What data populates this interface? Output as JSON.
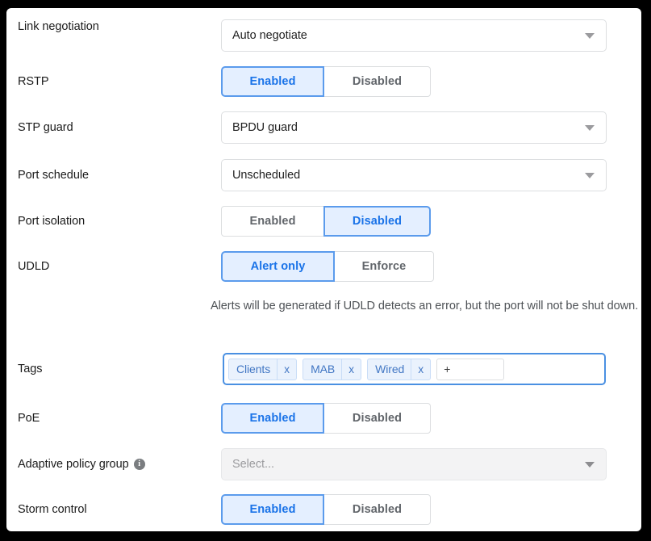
{
  "rows": [
    {
      "label": "Link negotiation",
      "type": "select",
      "value": "Auto negotiate",
      "disabled": false
    },
    {
      "label": "RSTP",
      "type": "toggle",
      "options": [
        "Enabled",
        "Disabled"
      ],
      "selected": "Enabled"
    },
    {
      "label": "STP guard",
      "type": "select",
      "value": "BPDU guard",
      "disabled": false
    },
    {
      "label": "Port schedule",
      "type": "select",
      "value": "Unscheduled",
      "disabled": false
    },
    {
      "label": "Port isolation",
      "type": "toggle",
      "options": [
        "Enabled",
        "Disabled"
      ],
      "selected": "Disabled"
    },
    {
      "label": "UDLD",
      "type": "toggle",
      "options": [
        "Alert only",
        "Enforce"
      ],
      "selected": "Alert only",
      "helper": "Alerts will be generated if UDLD detects an error, but the port will not be shut down."
    },
    {
      "label": "Tags",
      "type": "tags",
      "chips": [
        "Clients",
        "MAB",
        "Wired"
      ],
      "remove_glyph": "x",
      "add_glyph": "+"
    },
    {
      "label": "PoE",
      "type": "toggle",
      "options": [
        "Enabled",
        "Disabled"
      ],
      "selected": "Enabled"
    },
    {
      "label": "Adaptive policy group",
      "type": "select",
      "value": "Select...",
      "disabled": true,
      "info": true,
      "info_glyph": "i"
    },
    {
      "label": "Storm control",
      "type": "toggle",
      "options": [
        "Enabled",
        "Disabled"
      ],
      "selected": "Enabled"
    }
  ],
  "labels": {
    "link_negotiation": "Link negotiation",
    "rstp": "RSTP",
    "stp_guard": "STP guard",
    "port_schedule": "Port schedule",
    "port_isolation": "Port isolation",
    "udld": "UDLD",
    "tags": "Tags",
    "poe": "PoE",
    "adaptive_policy_group": "Adaptive policy group",
    "storm_control": "Storm control"
  },
  "values": {
    "link_negotiation": "Auto negotiate",
    "stp_guard": "BPDU guard",
    "port_schedule": "Unscheduled",
    "adaptive_policy_group_placeholder": "Select..."
  },
  "toggles": {
    "enabled": "Enabled",
    "disabled": "Disabled",
    "alert_only": "Alert only",
    "enforce": "Enforce"
  },
  "helper": {
    "udld": "Alerts will be generated if UDLD detects an error, but the port will not be shut down."
  },
  "tags": {
    "chip1": "Clients",
    "chip2": "MAB",
    "chip3": "Wired",
    "remove": "x",
    "add": "+"
  },
  "icons": {
    "info": "i"
  },
  "colors": {
    "accent_blue": "#1a73e8",
    "active_fill": "#e4efff",
    "active_border": "#5b9bec",
    "border_gray": "#dcdee0",
    "text": "#1b1b1b",
    "muted_text": "#62666b",
    "chip_fill": "#eaf2fd",
    "chip_text": "#4277c4",
    "tagbox_border": "#4a90e2",
    "disabled_fill": "#f3f3f4"
  }
}
